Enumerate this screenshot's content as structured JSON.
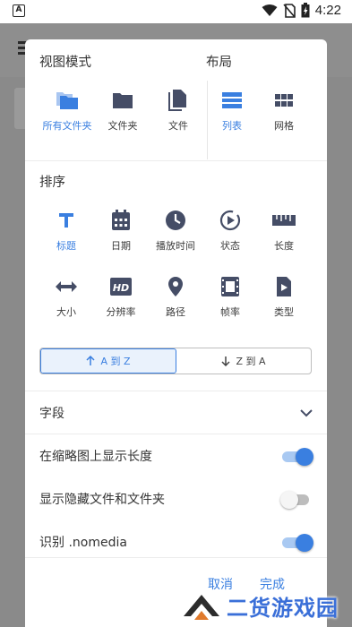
{
  "status_bar": {
    "time": "4:22",
    "notif_glyph": "A"
  },
  "dialog": {
    "view_mode": {
      "title": "视图模式",
      "options": [
        {
          "label": "所有文件夹",
          "icon": "folders-stack-icon",
          "active": true
        },
        {
          "label": "文件夹",
          "icon": "folder-icon",
          "active": false
        },
        {
          "label": "文件",
          "icon": "file-copy-icon",
          "active": false
        }
      ]
    },
    "layout": {
      "title": "布局",
      "options": [
        {
          "label": "列表",
          "icon": "list-icon",
          "active": true
        },
        {
          "label": "网格",
          "icon": "grid-icon",
          "active": false
        }
      ]
    },
    "sort": {
      "title": "排序",
      "options": [
        {
          "label": "标题",
          "icon": "title-t-icon",
          "active": true
        },
        {
          "label": "日期",
          "icon": "calendar-icon",
          "active": false
        },
        {
          "label": "播放时间",
          "icon": "clock-icon",
          "active": false
        },
        {
          "label": "状态",
          "icon": "play-status-icon",
          "active": false
        },
        {
          "label": "长度",
          "icon": "ruler-icon",
          "active": false
        },
        {
          "label": "大小",
          "icon": "arrows-horizontal-icon",
          "active": false
        },
        {
          "label": "分辨率",
          "icon": "hd-icon",
          "active": false
        },
        {
          "label": "路径",
          "icon": "location-pin-icon",
          "active": false
        },
        {
          "label": "帧率",
          "icon": "film-icon",
          "active": false
        },
        {
          "label": "类型",
          "icon": "video-file-icon",
          "active": false
        }
      ],
      "order": {
        "asc_label": "A 到 Z",
        "desc_label": "Z 到 A",
        "active": "asc"
      }
    },
    "fields": {
      "label": "字段"
    },
    "toggles": [
      {
        "label": "在缩略图上显示长度",
        "on": true
      },
      {
        "label": "显示隐藏文件和文件夹",
        "on": false
      },
      {
        "label": "识别 .nomedia",
        "on": true
      }
    ],
    "buttons": {
      "cancel": "取消",
      "done": "完成"
    }
  },
  "watermark": {
    "text": "二货游戏园"
  },
  "colors": {
    "accent": "#3a7fe0",
    "icon": "#454d66"
  }
}
